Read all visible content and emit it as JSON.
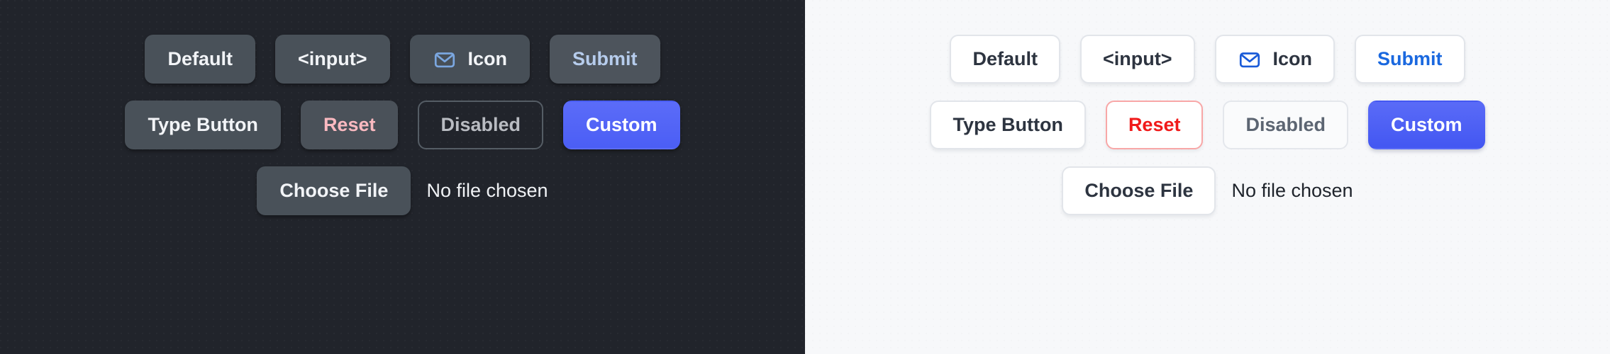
{
  "panels": [
    {
      "theme": "dark",
      "background_color": "#21242b",
      "rows": [
        {
          "buttons": [
            {
              "label": "Default",
              "name": "default-button",
              "icon": null
            },
            {
              "label": "<input>",
              "name": "input-button",
              "icon": null
            },
            {
              "label": "Icon",
              "name": "icon-button",
              "icon": "envelope-icon",
              "icon_color": "#7ba7e0"
            },
            {
              "label": "Submit",
              "name": "submit-button",
              "icon": null,
              "text_color": "#b6ccec"
            }
          ]
        },
        {
          "buttons": [
            {
              "label": "Type Button",
              "name": "type-button",
              "icon": null
            },
            {
              "label": "Reset",
              "name": "reset-button",
              "icon": null,
              "text_color": "#fab9c0"
            },
            {
              "label": "Disabled",
              "name": "disabled-button",
              "icon": null,
              "disabled": true
            },
            {
              "label": "Custom",
              "name": "custom-button",
              "icon": null,
              "background_color": "#4b5ef5"
            }
          ]
        }
      ],
      "file_input": {
        "button_label": "Choose File",
        "status_text": "No file chosen"
      }
    },
    {
      "theme": "light",
      "background_color": "#f7f8fa",
      "rows": [
        {
          "buttons": [
            {
              "label": "Default",
              "name": "default-button",
              "icon": null
            },
            {
              "label": "<input>",
              "name": "input-button",
              "icon": null
            },
            {
              "label": "Icon",
              "name": "icon-button",
              "icon": "envelope-icon",
              "icon_color": "#1a5bd8"
            },
            {
              "label": "Submit",
              "name": "submit-button",
              "icon": null,
              "text_color": "#1a68df"
            }
          ]
        },
        {
          "buttons": [
            {
              "label": "Type Button",
              "name": "type-button",
              "icon": null
            },
            {
              "label": "Reset",
              "name": "reset-button",
              "icon": null,
              "text_color": "#f01a1a",
              "border_color": "#f8a7a7"
            },
            {
              "label": "Disabled",
              "name": "disabled-button",
              "icon": null,
              "disabled": true
            },
            {
              "label": "Custom",
              "name": "custom-button",
              "icon": null,
              "background_color": "#4357f2"
            }
          ]
        }
      ],
      "file_input": {
        "button_label": "Choose File",
        "status_text": "No file chosen"
      }
    }
  ]
}
